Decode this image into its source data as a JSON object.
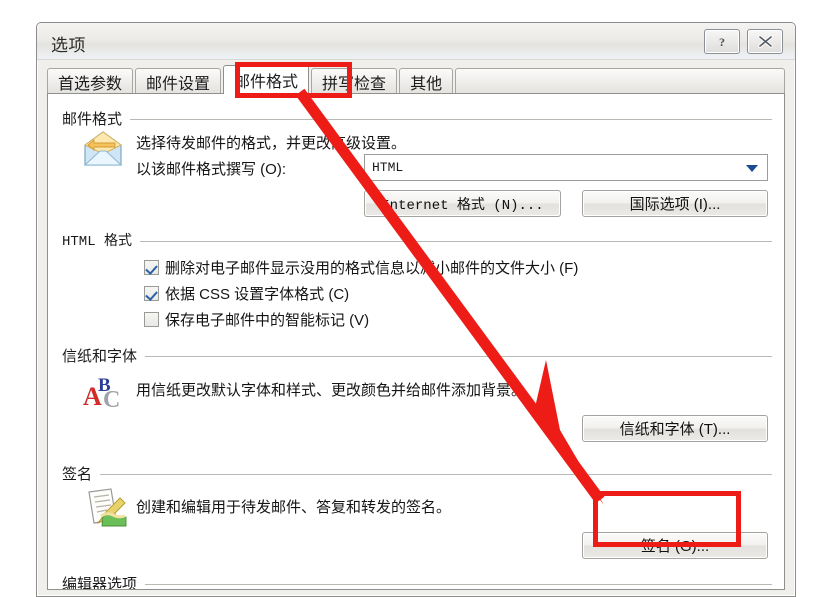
{
  "window": {
    "title": "选项",
    "help_button": "?",
    "close_button": "✕"
  },
  "tabs": [
    {
      "label": "首选参数",
      "selected": false
    },
    {
      "label": "邮件设置",
      "selected": false
    },
    {
      "label": "邮件格式",
      "selected": true
    },
    {
      "label": "拼写检查",
      "selected": false
    },
    {
      "label": "其他",
      "selected": false
    }
  ],
  "groups": {
    "mail_format": {
      "title": "邮件格式",
      "description": "选择待发邮件的格式，并更改高级设置。",
      "compose_label": "以该邮件格式撰写 (O):",
      "compose_value": "HTML",
      "internet_format_button": "Internet 格式 (N)...",
      "international_options_button": "国际选项 (I)..."
    },
    "html_format": {
      "title": "HTML 格式",
      "checkboxes": [
        {
          "label": "删除对电子邮件显示没用的格式信息以减小邮件的文件大小 (F)",
          "checked": true
        },
        {
          "label": "依据 CSS 设置字体格式 (C)",
          "checked": true
        },
        {
          "label": "保存电子邮件中的智能标记 (V)",
          "checked": false
        }
      ]
    },
    "stationery_fonts": {
      "title": "信纸和字体",
      "description": "用信纸更改默认字体和样式、更改颜色并给邮件添加背景。",
      "button": "信纸和字体 (T)..."
    },
    "signature": {
      "title": "签名",
      "description": "创建和编辑用于待发邮件、答复和转发的签名。",
      "button": "签名 (G)..."
    },
    "editor_options": {
      "title": "编辑器选项"
    }
  },
  "annotations": {
    "highlight_color": "#ee1c16",
    "tab_highlight_target": "邮件格式",
    "button_highlight_target": "签名 (G)...",
    "arrow_from": "邮件格式",
    "arrow_to": "签名 (G)..."
  },
  "icons": {
    "envelope": "envelope-icon",
    "stationery": "stationery-abc-icon",
    "signature": "signature-pen-icon",
    "dropdown": "chevron-down-icon",
    "help": "help-icon",
    "close": "close-icon"
  }
}
